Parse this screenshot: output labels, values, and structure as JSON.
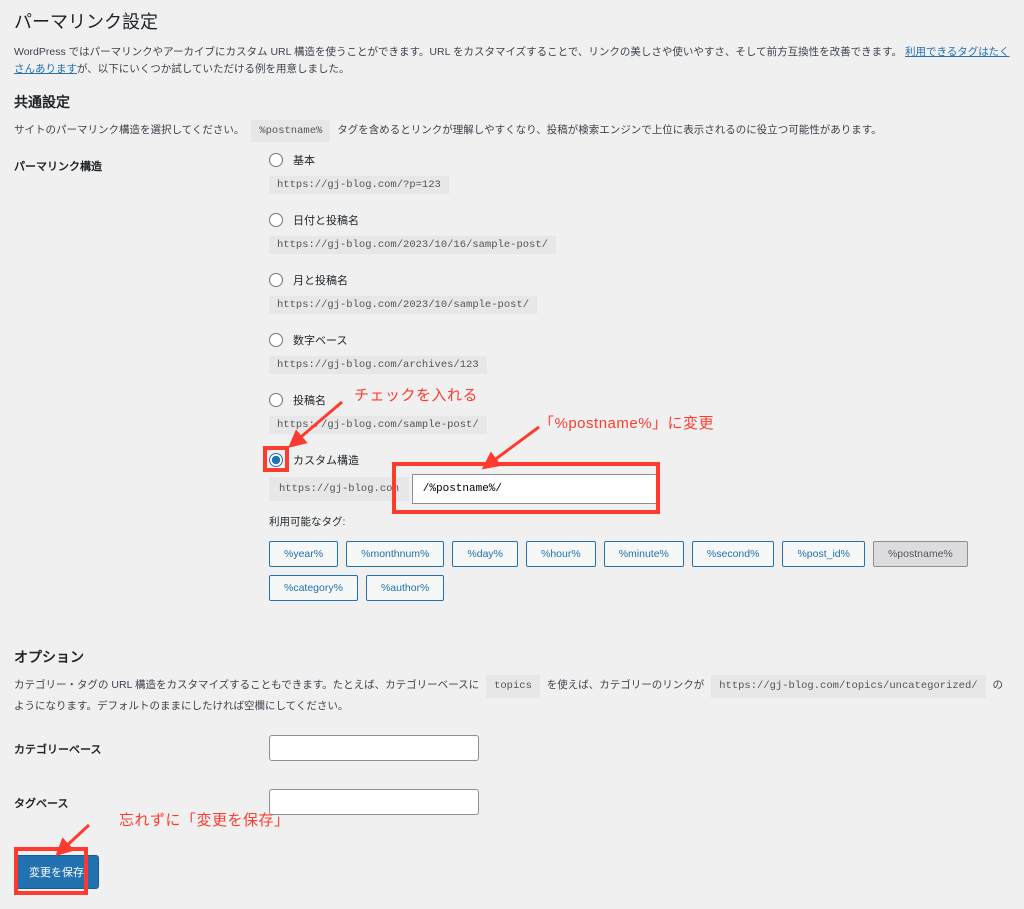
{
  "page": {
    "title": "パーマリンク設定",
    "intro_before_link": "WordPress ではパーマリンクやアーカイブにカスタム URL 構造を使うことができます。URL をカスタマイズすることで、リンクの美しさや使いやすさ、そして前方互換性を改善できます。",
    "intro_link": "利用できるタグはたくさんあります",
    "intro_after_link": "が、以下にいくつか試していただける例を用意しました。"
  },
  "common": {
    "heading": "共通設定",
    "desc_before": "サイトのパーマリンク構造を選択してください。",
    "inline_tag": "%postname%",
    "desc_after": "タグを含めるとリンクが理解しやすくなり、投稿が検索エンジンで上位に表示されるのに役立つ可能性があります。"
  },
  "structure": {
    "label": "パーマリンク構造",
    "options": [
      {
        "name": "基本",
        "example": "https://gj-blog.com/?p=123"
      },
      {
        "name": "日付と投稿名",
        "example": "https://gj-blog.com/2023/10/16/sample-post/"
      },
      {
        "name": "月と投稿名",
        "example": "https://gj-blog.com/2023/10/sample-post/"
      },
      {
        "name": "数字ベース",
        "example": "https://gj-blog.com/archives/123"
      },
      {
        "name": "投稿名",
        "example": "https://gj-blog.com/sample-post/"
      }
    ],
    "custom": {
      "name": "カスタム構造",
      "prefix": "https://gj-blog.com",
      "value": "/%postname%/"
    },
    "available_tags_label": "利用可能なタグ:",
    "tags": [
      "%year%",
      "%monthnum%",
      "%day%",
      "%hour%",
      "%minute%",
      "%second%",
      "%post_id%",
      "%postname%",
      "%category%",
      "%author%"
    ],
    "tag_active_index": 7
  },
  "option_section": {
    "heading": "オプション",
    "desc_before": "カテゴリー・タグの URL 構造をカスタマイズすることもできます。たとえば、カテゴリーベースに",
    "code1": "topics",
    "desc_mid": "を使えば、カテゴリーのリンクが",
    "code2": "https://gj-blog.com/topics/uncategorized/",
    "desc_after": "のようになります。デフォルトのままにしたければ空欄にしてください。"
  },
  "category_base": {
    "label": "カテゴリーベース",
    "value": ""
  },
  "tag_base": {
    "label": "タグベース",
    "value": ""
  },
  "submit": {
    "label": "変更を保存"
  },
  "annotations": {
    "check": "チェックを入れる",
    "postname": "「%postname%」に変更",
    "save": "忘れずに「変更を保存」"
  }
}
